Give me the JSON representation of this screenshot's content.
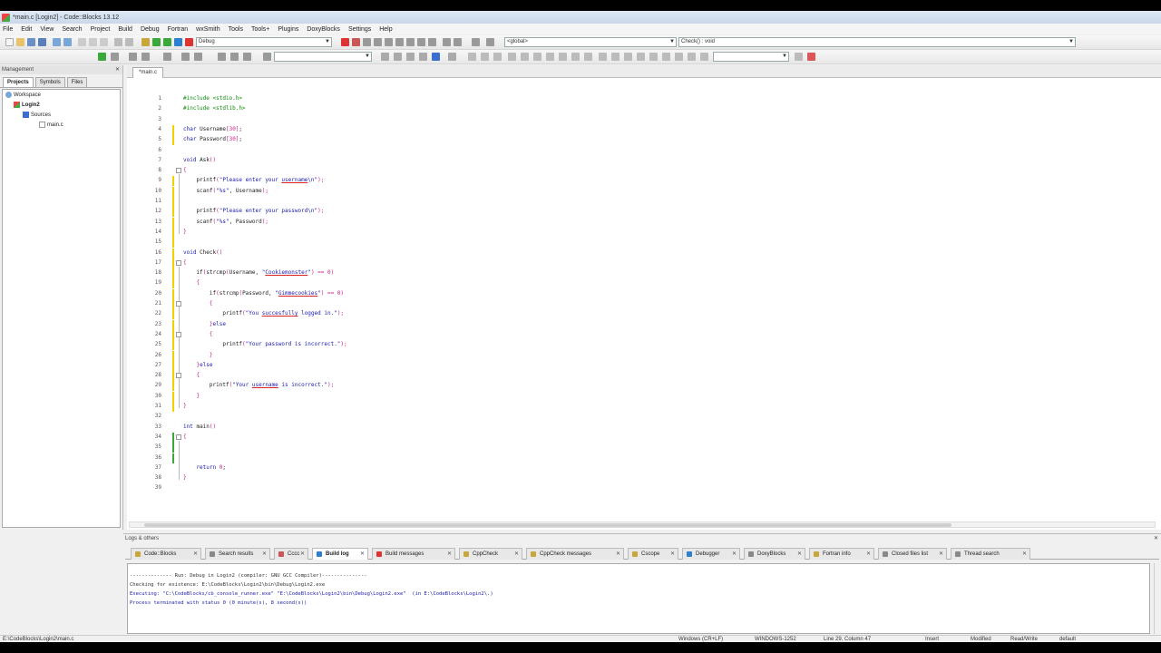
{
  "window": {
    "title": "*main.c [Login2] - Code::Blocks 13.12"
  },
  "menu": [
    "File",
    "Edit",
    "View",
    "Search",
    "Project",
    "Build",
    "Debug",
    "Fortran",
    "wxSmith",
    "Tools",
    "Tools+",
    "Plugins",
    "DoxyBlocks",
    "Settings",
    "Help"
  ],
  "toolbar": {
    "build_target": "Debug",
    "scope": "<global>",
    "function": "Check() : void"
  },
  "management": {
    "title": "Management",
    "tabs": [
      "Projects",
      "Symbols",
      "Files"
    ],
    "tree": {
      "workspace": "Workspace",
      "project": "Login2",
      "folder": "Sources",
      "file": "main.c"
    }
  },
  "editor": {
    "tab": "*main.c",
    "lines": [
      [
        [
          "pp",
          "#include <stdio.h>"
        ]
      ],
      [
        [
          "pp",
          "#include <stdlib.h>"
        ]
      ],
      [],
      [
        [
          "kw",
          "char"
        ],
        [
          "",
          " Username"
        ],
        [
          "op",
          "[30]"
        ],
        [
          "",
          ";"
        ]
      ],
      [
        [
          "kw",
          "char"
        ],
        [
          "",
          " Password"
        ],
        [
          "op",
          "[30]"
        ],
        [
          "",
          ";"
        ]
      ],
      [],
      [
        [
          "kw",
          "void"
        ],
        [
          "",
          " Ask"
        ],
        [
          "op",
          "()"
        ]
      ],
      [
        [
          "op",
          "{"
        ]
      ],
      [
        [
          "",
          "    printf"
        ],
        [
          "op",
          "("
        ],
        [
          "st",
          "\"Please enter your "
        ],
        [
          "st hl",
          "username"
        ],
        [
          "st",
          "\\n\""
        ],
        [
          "op",
          ");"
        ]
      ],
      [
        [
          "",
          "    scanf"
        ],
        [
          "op",
          "("
        ],
        [
          "st",
          "\"%s\""
        ],
        [
          "",
          ", Username"
        ],
        [
          "op",
          ");"
        ]
      ],
      [],
      [
        [
          "",
          "    printf"
        ],
        [
          "op",
          "("
        ],
        [
          "st",
          "\"Please enter your password\\n\""
        ],
        [
          "op",
          ");"
        ]
      ],
      [
        [
          "",
          "    scanf"
        ],
        [
          "op",
          "("
        ],
        [
          "st",
          "\"%s\""
        ],
        [
          "",
          ", Password"
        ],
        [
          "op",
          ");"
        ]
      ],
      [
        [
          "op",
          "}"
        ]
      ],
      [],
      [
        [
          "kw",
          "void"
        ],
        [
          "",
          " Check"
        ],
        [
          "op",
          "()"
        ]
      ],
      [
        [
          "op",
          "{"
        ]
      ],
      [
        [
          "",
          "    if"
        ],
        [
          "op",
          "("
        ],
        [
          "",
          "strcmp"
        ],
        [
          "op",
          "("
        ],
        [
          "",
          "Username, "
        ],
        [
          "st",
          "\""
        ],
        [
          "st hl",
          "Cookiemonster"
        ],
        [
          "st",
          "\""
        ],
        [
          "op",
          ") == "
        ],
        [
          "nm",
          "0"
        ],
        [
          "op",
          ")"
        ]
      ],
      [
        [
          "op",
          "    {"
        ]
      ],
      [
        [
          "",
          "        if"
        ],
        [
          "op",
          "("
        ],
        [
          "",
          "strcmp"
        ],
        [
          "op",
          "("
        ],
        [
          "",
          "Password, "
        ],
        [
          "st",
          "\""
        ],
        [
          "st hl",
          "Gimmecookies"
        ],
        [
          "st",
          "\""
        ],
        [
          "op",
          ") == "
        ],
        [
          "nm",
          "0"
        ],
        [
          "op",
          ")"
        ]
      ],
      [
        [
          "op",
          "        {"
        ]
      ],
      [
        [
          "",
          "            printf"
        ],
        [
          "op",
          "("
        ],
        [
          "st",
          "\"You "
        ],
        [
          "st hl",
          "succesfully"
        ],
        [
          "st",
          " logged in.\""
        ],
        [
          "op",
          ");"
        ]
      ],
      [
        [
          "op",
          "        }"
        ],
        [
          "kw",
          "else"
        ]
      ],
      [
        [
          "op",
          "        {"
        ]
      ],
      [
        [
          "",
          "            printf"
        ],
        [
          "op",
          "("
        ],
        [
          "st",
          "\"Your password is incorrect.\""
        ],
        [
          "op",
          ");"
        ]
      ],
      [
        [
          "op",
          "        }"
        ]
      ],
      [
        [
          "op",
          "    }"
        ],
        [
          "kw",
          "else"
        ]
      ],
      [
        [
          "op",
          "    {"
        ]
      ],
      [
        [
          "",
          "        printf"
        ],
        [
          "op",
          "("
        ],
        [
          "st",
          "\"Your "
        ],
        [
          "st hl",
          "username"
        ],
        [
          "st",
          " is incorrect.\""
        ],
        [
          "op",
          ");"
        ]
      ],
      [
        [
          "op",
          "    }"
        ]
      ],
      [
        [
          "op",
          "}"
        ]
      ],
      [],
      [
        [
          "kw",
          "int"
        ],
        [
          "",
          " main"
        ],
        [
          "op",
          "()"
        ]
      ],
      [
        [
          "op",
          "{"
        ]
      ],
      [],
      [],
      [
        [
          "kw",
          "    return"
        ],
        [
          "",
          " "
        ],
        [
          "nm",
          "0"
        ],
        [
          "",
          ";"
        ]
      ],
      [
        [
          "op",
          "}"
        ]
      ],
      []
    ]
  },
  "logs": {
    "title": "Logs & others",
    "tabs": [
      "Code::Blocks",
      "Search results",
      "Cccc",
      "Build log",
      "Build messages",
      "CppCheck",
      "CppCheck messages",
      "Cscope",
      "Debugger",
      "DoxyBlocks",
      "Fortran info",
      "Closed files list",
      "Thread search"
    ],
    "lines": [
      "-------------- Run: Debug in Login2 (compiler: GNU GCC Compiler)---------------",
      "Checking for existence: E:\\CodeBlocks\\Login2\\bin\\Debug\\Login2.exe",
      "Executing: \"C:\\CodeBlocks/cb_console_runner.exe\" \"E:\\CodeBlocks\\Login2\\bin\\Debug\\Login2.exe\"  (in E:\\CodeBlocks\\Login2\\.)",
      "Process terminated with status 0 (0 minute(s), 8 second(s))"
    ]
  },
  "status": {
    "path": "E:\\CodeBlocks\\Login2\\main.c",
    "eol": "Windows (CR+LF)",
    "encoding": "WINDOWS-1252",
    "position": "Line 29, Column 47",
    "mode": "Insert",
    "modified": "Modified",
    "rw": "Read/Write",
    "profile": "default"
  }
}
